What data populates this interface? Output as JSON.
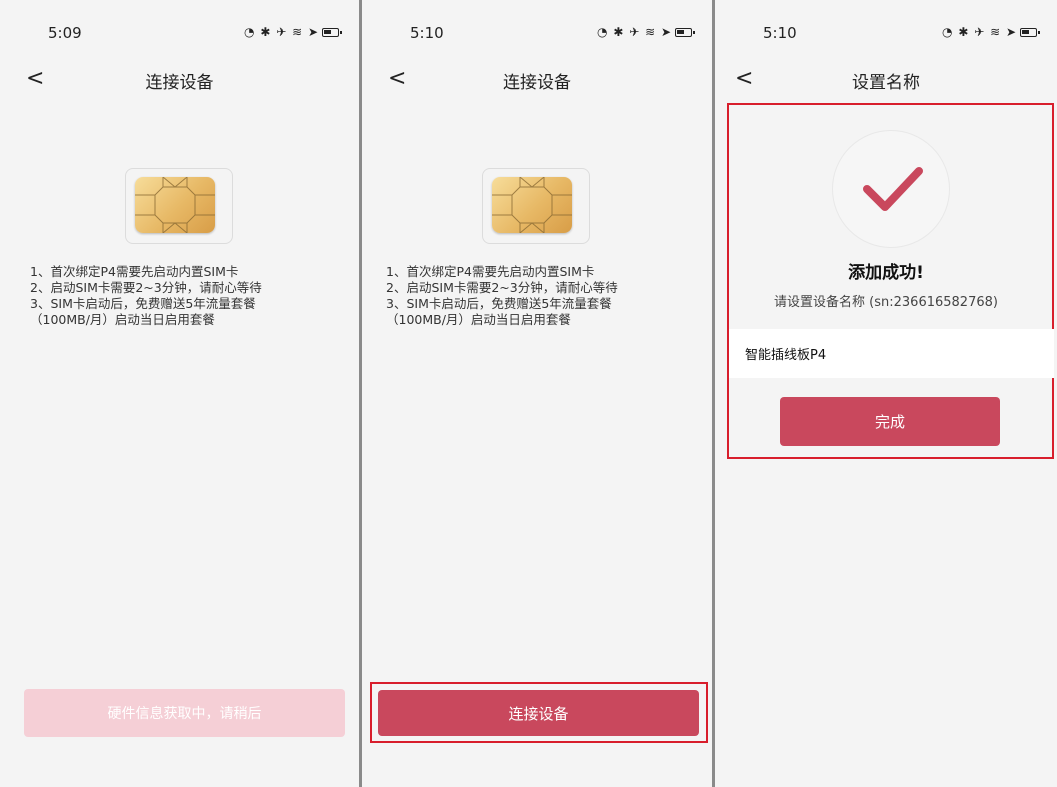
{
  "screens": [
    {
      "status": {
        "time": "5:09"
      },
      "nav": {
        "back": "<",
        "title": "连接设备"
      },
      "instructions": [
        "1、首次绑定P4需要先启动内置SIM卡",
        "2、启动SIM卡需要2~3分钟，请耐心等待",
        "3、SIM卡启动后，免费赠送5年流量套餐",
        "（100MB/月）启动当日启用套餐"
      ],
      "button": {
        "label": "硬件信息获取中，请稍后",
        "state": "disabled"
      }
    },
    {
      "status": {
        "time": "5:10"
      },
      "nav": {
        "back": "<",
        "title": "连接设备"
      },
      "instructions": [
        "1、首次绑定P4需要先启动内置SIM卡",
        "2、启动SIM卡需要2~3分钟，请耐心等待",
        "3、SIM卡启动后，免费赠送5年流量套餐",
        "（100MB/月）启动当日启用套餐"
      ],
      "button": {
        "label": "连接设备",
        "state": "enabled"
      }
    },
    {
      "status": {
        "time": "5:10"
      },
      "nav": {
        "back": "<",
        "title": "设置名称"
      },
      "success_title": "添加成功!",
      "success_subtitle": "请设置设备名称 (sn:236616582768)",
      "name_input": {
        "value": "智能插线板P4"
      },
      "button": {
        "label": "完成"
      }
    }
  ],
  "colors": {
    "primary": "#c9485d",
    "primary_disabled": "#f5cfd6",
    "highlight_border": "#d81e2c",
    "background": "#f4f4f4"
  },
  "icons": [
    "status-icons",
    "back-chevron-icon",
    "sim-card-icon",
    "checkmark-icon"
  ]
}
